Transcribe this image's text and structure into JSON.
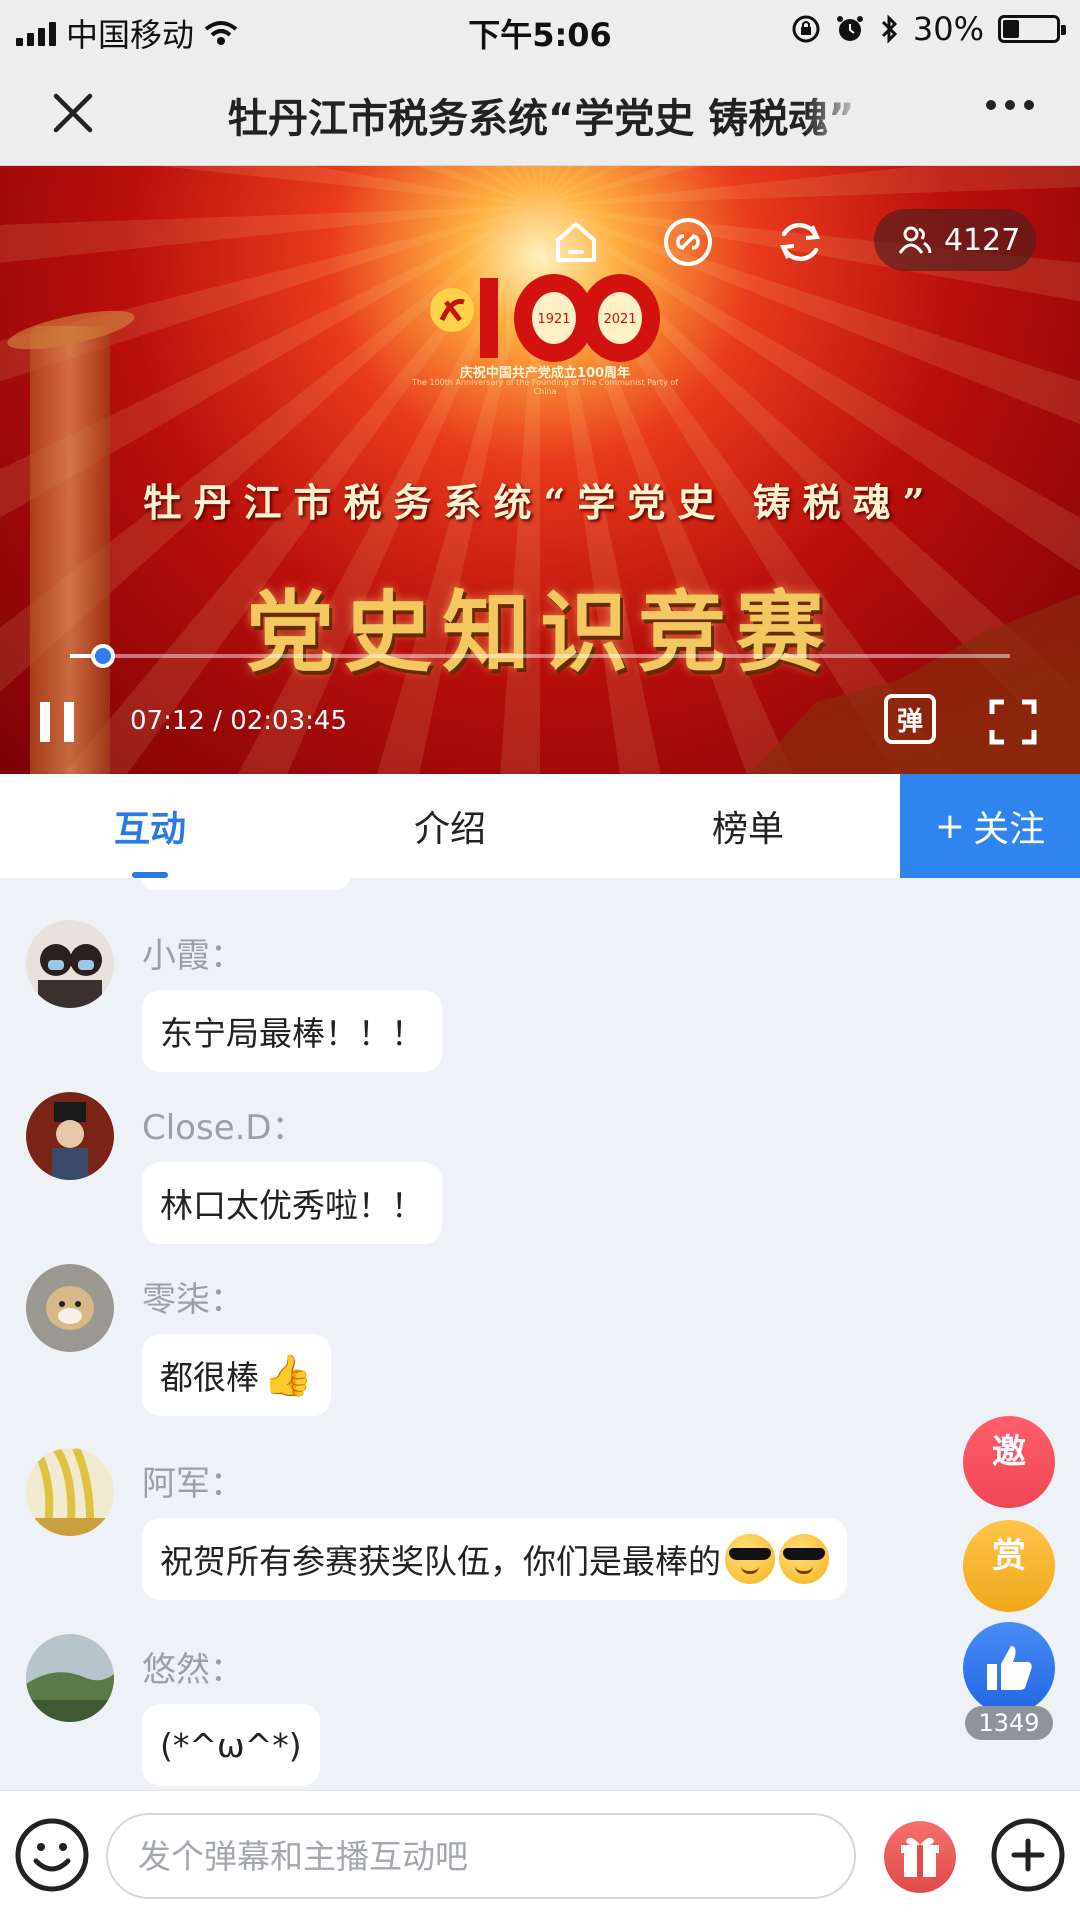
{
  "status_bar": {
    "carrier": "中国移动",
    "time": "下午5:06",
    "battery": "30%",
    "battery_level": 0.3
  },
  "nav": {
    "title": "牡丹江市税务系统“学党史 铸税魂”",
    "close_icon": "close-icon",
    "more_icon": "more-icon"
  },
  "video": {
    "emblem_caption_cn": "庆祝中国共产党成立100周年",
    "emblem_caption_en": "The 100th Anniversary of the Founding of The Communist Party of China",
    "emblem_years": [
      "1921",
      "2021"
    ],
    "emblem_number": "100",
    "banner_title": "牡丹江市税务系统“学党史 铸税魂”",
    "banner_main": "党史知识竞赛",
    "viewer_count": "4127",
    "time_display": "07:12 / 02:03:45",
    "progress_fraction": 0.0355,
    "danmu_label": "弹",
    "icons": [
      "home-icon",
      "link-icon",
      "refresh-icon",
      "viewers-icon",
      "pause-icon",
      "danmu-icon",
      "fullscreen-icon"
    ]
  },
  "tabs": {
    "interact": "互动",
    "intro": "介绍",
    "ranking": "榜单",
    "follow": "关注",
    "follow_prefix": "+"
  },
  "chat": {
    "messages": [
      {
        "sender": "小霞：",
        "text": "东宁局最棒！！！"
      },
      {
        "sender": "Close.D：",
        "text": "林口太优秀啦！！"
      },
      {
        "sender": "零柒：",
        "text": "都很棒"
      },
      {
        "sender": "阿军：",
        "text": "祝贺所有参赛获奖队伍，你们是最棒的"
      },
      {
        "sender": "悠然：",
        "text": "(*^ω^*)"
      }
    ]
  },
  "floating": {
    "invite": "邀",
    "reward": "赏",
    "like_count": "1349"
  },
  "input": {
    "placeholder": "发个弹幕和主播互动吧"
  },
  "colors": {
    "accent": "#2a7ae2",
    "follow_bg": "#2f84ee",
    "invite": "#f04656",
    "reward": "#f0a71c",
    "like": "#2166e3"
  }
}
